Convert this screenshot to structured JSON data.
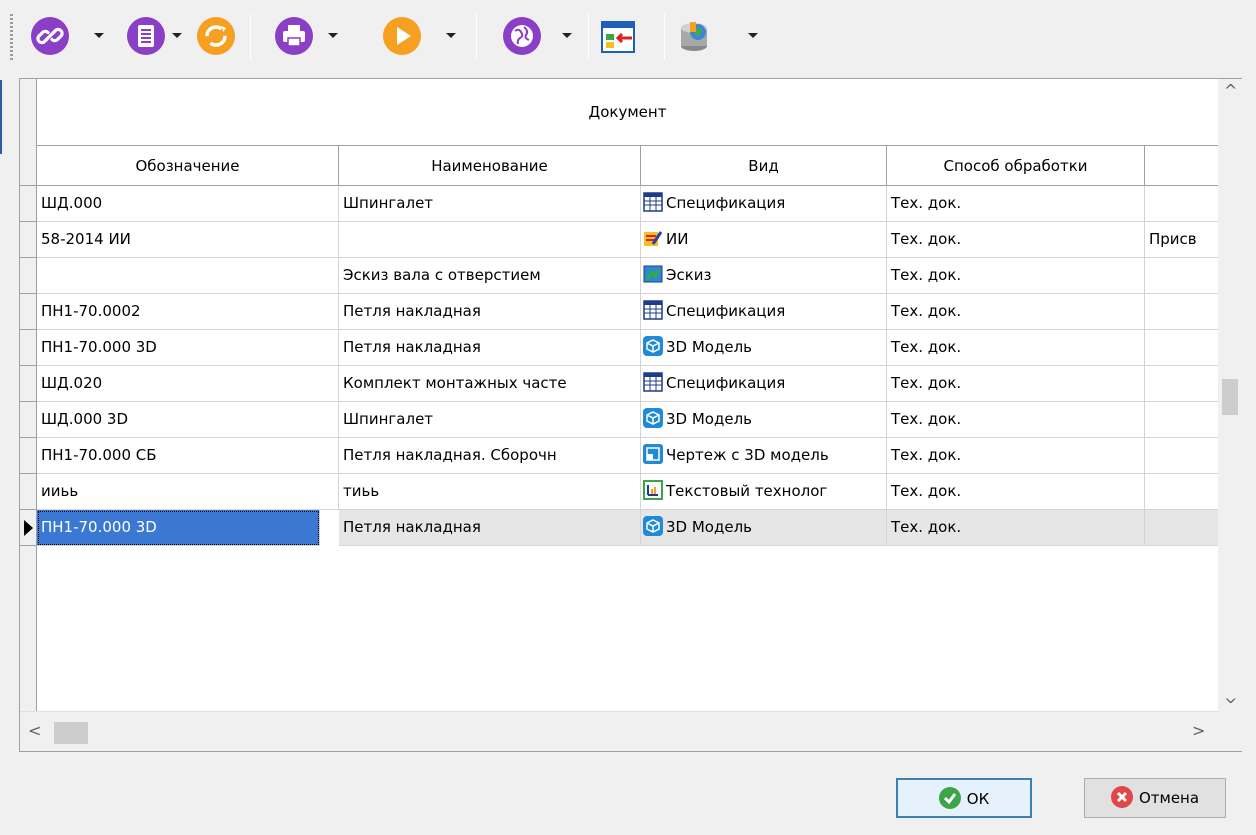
{
  "toolbar": {
    "buttons": [
      {
        "icon": "link-icon",
        "color": "#8a3fc6",
        "has_dropdown": true
      },
      {
        "icon": "document-list-icon",
        "color": "#8a3fc6",
        "has_dropdown": true
      },
      {
        "icon": "refresh-icon",
        "color": "#f5a020",
        "has_dropdown": false
      },
      {
        "icon": "print-icon",
        "color": "#8a3fc6",
        "has_dropdown": true
      },
      {
        "icon": "play-icon",
        "color": "#f5a020",
        "has_dropdown": true
      },
      {
        "icon": "globe-icon",
        "color": "#8a3fc6",
        "has_dropdown": true
      },
      {
        "icon": "import-window-icon",
        "color": "#1e5fb8",
        "has_dropdown": false
      },
      {
        "icon": "database-icon",
        "color": "#4a8a3a",
        "has_dropdown": true
      }
    ]
  },
  "grid": {
    "band_title": "Документ",
    "columns": [
      {
        "label": "Обозначение"
      },
      {
        "label": "Наименование"
      },
      {
        "label": "Вид"
      },
      {
        "label": "Способ обработки"
      },
      {
        "label": ""
      }
    ],
    "rows": [
      {
        "designation": "ШД.000",
        "name": "Шпингалет",
        "type_icon": "specification-icon",
        "type": "Спецификация",
        "processing": "Тех. док.",
        "extra": ""
      },
      {
        "designation": "58-2014 ИИ",
        "name": "",
        "type_icon": "ii-icon",
        "type": "ИИ",
        "processing": "Тех. док.",
        "extra": "Присв"
      },
      {
        "designation": "",
        "name": "Эскиз вала с отверстием",
        "type_icon": "sketch-icon",
        "type": "Эскиз",
        "processing": "Тех. док.",
        "extra": ""
      },
      {
        "designation": "ПН1-70.0002",
        "name": "Петля накладная",
        "type_icon": "specification-icon",
        "type": "Спецификация",
        "processing": "Тех. док.",
        "extra": ""
      },
      {
        "designation": "ПН1-70.000 3D",
        "name": "Петля накладная",
        "type_icon": "3d-model-icon",
        "type": "3D Модель",
        "processing": "Тех. док.",
        "extra": ""
      },
      {
        "designation": "ШД.020",
        "name": "Комплект монтажных часте",
        "type_icon": "specification-icon",
        "type": "Спецификация",
        "processing": "Тех. док.",
        "extra": ""
      },
      {
        "designation": "ШД.000 3D",
        "name": "Шпингалет",
        "type_icon": "3d-model-icon",
        "type": "3D Модель",
        "processing": "Тех. док.",
        "extra": ""
      },
      {
        "designation": "ПН1-70.000 СБ",
        "name": "Петля накладная. Сборочн",
        "type_icon": "drawing-3d-icon",
        "type": "Чертеж с 3D модель",
        "processing": "Тех. док.",
        "extra": ""
      },
      {
        "designation": "ииьь",
        "name": "тиьь",
        "type_icon": "text-tech-icon",
        "type": "Текстовый технолог",
        "processing": "Тех. док.",
        "extra": ""
      },
      {
        "designation": "ПН1-70.000 3D",
        "name": "Петля накладная",
        "type_icon": "3d-model-icon",
        "type": "3D Модель",
        "processing": "Тех. док.",
        "extra": ""
      }
    ],
    "selected_row_index": 9
  },
  "buttons": {
    "ok_label": "ОК",
    "cancel_label": "Отмена"
  },
  "colors": {
    "accent_purple": "#8a3fc6",
    "accent_orange": "#f5a020",
    "selection": "#3a78d4",
    "ok_green": "#3aa648",
    "cancel_red": "#e04848"
  }
}
